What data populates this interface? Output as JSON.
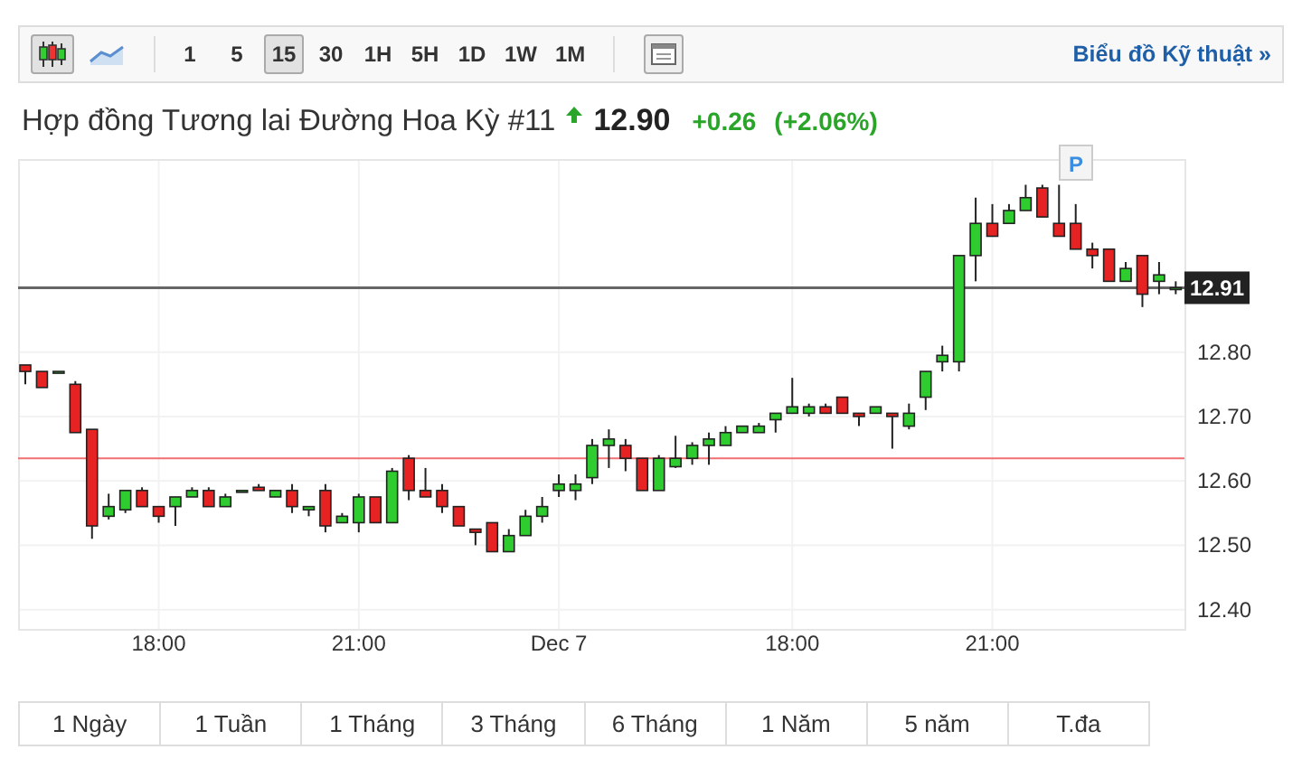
{
  "toolbar": {
    "chart_types": [
      {
        "kind": "candle",
        "selected": true
      },
      {
        "kind": "line",
        "selected": false
      }
    ],
    "intervals": [
      {
        "label": "1",
        "selected": false
      },
      {
        "label": "5",
        "selected": false
      },
      {
        "label": "15",
        "selected": true
      },
      {
        "label": "30",
        "selected": false
      },
      {
        "label": "1H",
        "selected": false
      },
      {
        "label": "5H",
        "selected": false
      },
      {
        "label": "1D",
        "selected": false
      },
      {
        "label": "1W",
        "selected": false
      },
      {
        "label": "1M",
        "selected": false
      }
    ],
    "link": "Biểu đồ Kỹ thuật »"
  },
  "quote": {
    "name": "Hợp đồng Tương lai Đường Hoa Kỳ #11",
    "up": true,
    "price": "12.90",
    "change": "+0.26",
    "change_pct": "(+2.06%)"
  },
  "chart": {
    "price_label": "12.91",
    "marker": "P",
    "chart_data": {
      "type": "candlestick",
      "ylim": [
        12.37,
        13.1
      ],
      "yticks": [
        {
          "value": 12.4,
          "label": "12.40"
        },
        {
          "value": 12.5,
          "label": "12.50"
        },
        {
          "value": 12.6,
          "label": "12.60"
        },
        {
          "value": 12.7,
          "label": "12.70"
        },
        {
          "value": 12.8,
          "label": "12.80"
        }
      ],
      "grid": true,
      "ref_lines": [
        {
          "axis": "y",
          "value": 12.9,
          "color": "#666666"
        },
        {
          "axis": "y",
          "value": 12.635,
          "color": "#f07070"
        }
      ],
      "categories": [
        null,
        null,
        null,
        null,
        null,
        null,
        null,
        null,
        "18:00",
        null,
        null,
        null,
        null,
        null,
        null,
        null,
        null,
        null,
        null,
        null,
        "21:00",
        null,
        null,
        null,
        null,
        null,
        null,
        null,
        null,
        null,
        null,
        null,
        "Dec 7",
        null,
        null,
        null,
        null,
        null,
        null,
        null,
        null,
        null,
        null,
        null,
        null,
        null,
        "18:00",
        null,
        null,
        null,
        null,
        null,
        null,
        null,
        null,
        null,
        null,
        null,
        "21:00",
        null,
        null,
        null,
        null,
        null,
        null,
        null,
        null,
        null,
        null,
        null
      ],
      "ohlc": [
        [
          12.78,
          12.78,
          12.75,
          12.77
        ],
        [
          12.77,
          12.77,
          12.745,
          12.745
        ],
        [
          12.77,
          12.77,
          12.77,
          12.77
        ],
        [
          12.75,
          12.755,
          12.675,
          12.675
        ],
        [
          12.68,
          12.68,
          12.51,
          12.53
        ],
        [
          12.545,
          12.58,
          12.54,
          12.56
        ],
        [
          12.555,
          12.585,
          12.55,
          12.585
        ],
        [
          12.585,
          12.59,
          12.56,
          12.56
        ],
        [
          12.56,
          12.56,
          12.535,
          12.545
        ],
        [
          12.56,
          12.575,
          12.53,
          12.575
        ],
        [
          12.575,
          12.59,
          12.575,
          12.585
        ],
        [
          12.585,
          12.59,
          12.56,
          12.56
        ],
        [
          12.56,
          12.58,
          12.56,
          12.575
        ],
        [
          12.585,
          12.585,
          12.585,
          12.585
        ],
        [
          12.59,
          12.595,
          12.585,
          12.585
        ],
        [
          12.575,
          12.585,
          12.575,
          12.585
        ],
        [
          12.585,
          12.595,
          12.55,
          12.56
        ],
        [
          12.555,
          12.56,
          12.545,
          12.56
        ],
        [
          12.585,
          12.595,
          12.52,
          12.53
        ],
        [
          12.535,
          12.55,
          12.535,
          12.545
        ],
        [
          12.535,
          12.58,
          12.52,
          12.575
        ],
        [
          12.575,
          12.575,
          12.535,
          12.535
        ],
        [
          12.535,
          12.62,
          12.535,
          12.615
        ],
        [
          12.635,
          12.64,
          12.57,
          12.585
        ],
        [
          12.585,
          12.62,
          12.575,
          12.575
        ],
        [
          12.585,
          12.595,
          12.55,
          12.56
        ],
        [
          12.56,
          12.56,
          12.53,
          12.53
        ],
        [
          12.525,
          12.525,
          12.5,
          12.52
        ],
        [
          12.535,
          12.535,
          12.49,
          12.49
        ],
        [
          12.49,
          12.525,
          12.49,
          12.515
        ],
        [
          12.515,
          12.555,
          12.515,
          12.545
        ],
        [
          12.545,
          12.575,
          12.535,
          12.56
        ],
        [
          12.585,
          12.61,
          12.575,
          12.595
        ],
        [
          12.585,
          12.61,
          12.57,
          12.595
        ],
        [
          12.605,
          12.665,
          12.595,
          12.655
        ],
        [
          12.655,
          12.68,
          12.62,
          12.665
        ],
        [
          12.655,
          12.665,
          12.615,
          12.635
        ],
        [
          12.635,
          12.635,
          12.585,
          12.585
        ],
        [
          12.585,
          12.64,
          12.585,
          12.635
        ],
        [
          12.622,
          12.67,
          12.62,
          12.635
        ],
        [
          12.635,
          12.66,
          12.625,
          12.655
        ],
        [
          12.655,
          12.675,
          12.625,
          12.665
        ],
        [
          12.655,
          12.685,
          12.655,
          12.675
        ],
        [
          12.675,
          12.685,
          12.675,
          12.685
        ],
        [
          12.675,
          12.69,
          12.675,
          12.685
        ],
        [
          12.695,
          12.705,
          12.675,
          12.705
        ],
        [
          12.705,
          12.76,
          12.705,
          12.715
        ],
        [
          12.705,
          12.72,
          12.7,
          12.715
        ],
        [
          12.715,
          12.72,
          12.705,
          12.705
        ],
        [
          12.73,
          12.73,
          12.705,
          12.705
        ],
        [
          12.705,
          12.705,
          12.685,
          12.7
        ],
        [
          12.705,
          12.715,
          12.705,
          12.715
        ],
        [
          12.705,
          12.705,
          12.65,
          12.7
        ],
        [
          12.685,
          12.72,
          12.68,
          12.705
        ],
        [
          12.73,
          12.77,
          12.71,
          12.77
        ],
        [
          12.785,
          12.81,
          12.77,
          12.795
        ],
        [
          12.785,
          12.95,
          12.77,
          12.95
        ],
        [
          12.95,
          13.04,
          12.91,
          13.0
        ],
        [
          13.0,
          13.03,
          12.98,
          12.98
        ],
        [
          13.0,
          13.03,
          13.0,
          13.02
        ],
        [
          13.02,
          13.06,
          13.02,
          13.04
        ],
        [
          13.055,
          13.06,
          13.01,
          13.01
        ],
        [
          13.0,
          13.06,
          12.98,
          12.98
        ],
        [
          13.0,
          13.03,
          12.96,
          12.96
        ],
        [
          12.96,
          12.97,
          12.93,
          12.95
        ],
        [
          12.96,
          12.96,
          12.91,
          12.91
        ],
        [
          12.91,
          12.94,
          12.91,
          12.93
        ],
        [
          12.95,
          12.95,
          12.87,
          12.89
        ],
        [
          12.91,
          12.94,
          12.89,
          12.92
        ],
        [
          12.9,
          12.91,
          12.89,
          12.9
        ]
      ]
    }
  },
  "ranges": [
    {
      "label": "1 Ngày"
    },
    {
      "label": "1 Tuần"
    },
    {
      "label": "1 Tháng"
    },
    {
      "label": "3 Tháng"
    },
    {
      "label": "6 Tháng"
    },
    {
      "label": "1 Năm"
    },
    {
      "label": "5 năm"
    },
    {
      "label": "T.đa"
    }
  ]
}
